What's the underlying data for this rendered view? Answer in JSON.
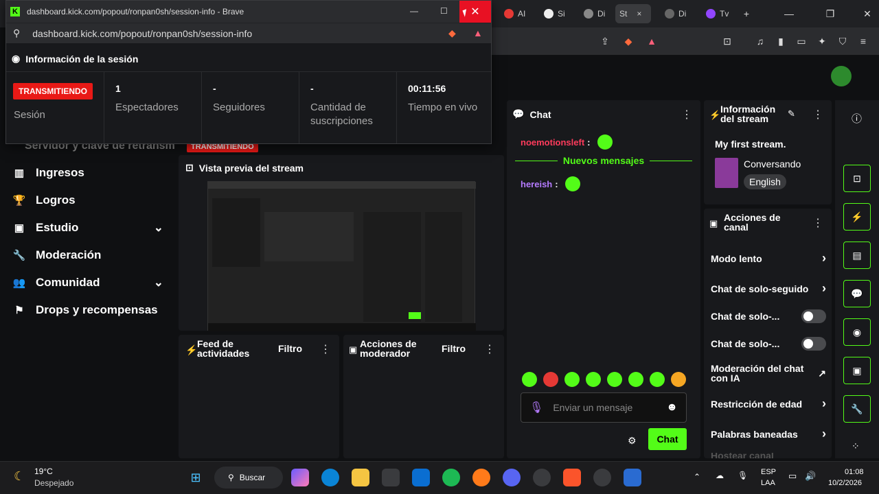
{
  "browser": {
    "tabs": [
      "AI",
      "Si",
      "Di",
      "St",
      "Di",
      "Tv"
    ],
    "active_tab_close": "×",
    "new_tab": "+"
  },
  "popout": {
    "title": "dashboard.kick.com/popout/ronpan0sh/session-info - Brave",
    "url": "dashboard.kick.com/popout/ronpan0sh/session-info",
    "header": "Información de la sesión",
    "live_badge": "TRANSMITIENDO",
    "session_label": "Sesión",
    "stats": [
      {
        "value": "1",
        "label": "Espectadores"
      },
      {
        "value": "-",
        "label": "Seguidores"
      },
      {
        "value": "-",
        "label": "Cantidad de suscripciones"
      },
      {
        "value": "00:11:56",
        "label": "Tiempo en vivo"
      }
    ]
  },
  "underlying": {
    "server_key": "Servidor y clave de retransm",
    "live_badge": "TRANSMITIENDO",
    "sidebar": [
      {
        "label": "Ingresos",
        "icon": "chart-icon",
        "glyph": "▥"
      },
      {
        "label": "Logros",
        "icon": "trophy-icon",
        "glyph": "🏆"
      },
      {
        "label": "Estudio",
        "icon": "studio-icon",
        "glyph": "▣",
        "expand": "⌄"
      },
      {
        "label": "Moderación",
        "icon": "wrench-icon",
        "glyph": "🔧"
      },
      {
        "label": "Comunidad",
        "icon": "community-icon",
        "glyph": "👥",
        "expand": "⌄"
      },
      {
        "label": "Drops y recompensas",
        "icon": "drops-icon",
        "glyph": "⚑"
      }
    ],
    "preview_title": "Vista previa del stream",
    "activity_feed": "Feed de actividades",
    "activity_filter": "Filtro",
    "mod_actions": "Acciones de moderador",
    "mod_filter": "Filtro"
  },
  "chat": {
    "title": "Chat",
    "messages": [
      {
        "user": "noemotionsleft",
        "color": "#ff3b5c"
      },
      {
        "divider": "Nuevos mensajes"
      },
      {
        "user": "hereish",
        "color": "#b57bff"
      }
    ],
    "input_placeholder": "Enviar un mensaje",
    "send": "Chat"
  },
  "stream_info": {
    "title": "Información del stream",
    "stream_title": "My first stream.",
    "category": "Conversando",
    "language": "English"
  },
  "channel_actions": {
    "title": "Acciones de canal",
    "items": [
      {
        "label": "Modo lento",
        "control": "chevron"
      },
      {
        "label": "Chat de solo-seguido",
        "control": "chevron"
      },
      {
        "label": "Chat de solo-...",
        "control": "toggle"
      },
      {
        "label": "Chat de solo-...",
        "control": "toggle"
      },
      {
        "label": "Moderación del chat con IA",
        "control": "external"
      },
      {
        "label": "Restricción de edad",
        "control": "chevron"
      },
      {
        "label": "Palabras baneadas",
        "control": "chevron"
      },
      {
        "label": "Hostear canal",
        "control": "chevron"
      }
    ]
  },
  "taskbar": {
    "temp": "19°C",
    "weather": "Despejado",
    "search": "Buscar",
    "lang1": "ESP",
    "lang2": "LAA",
    "time": "01:08",
    "date": "10/2/2026"
  },
  "colors": {
    "accent": "#53fc18",
    "live": "#e91916",
    "close": "#e81123"
  }
}
